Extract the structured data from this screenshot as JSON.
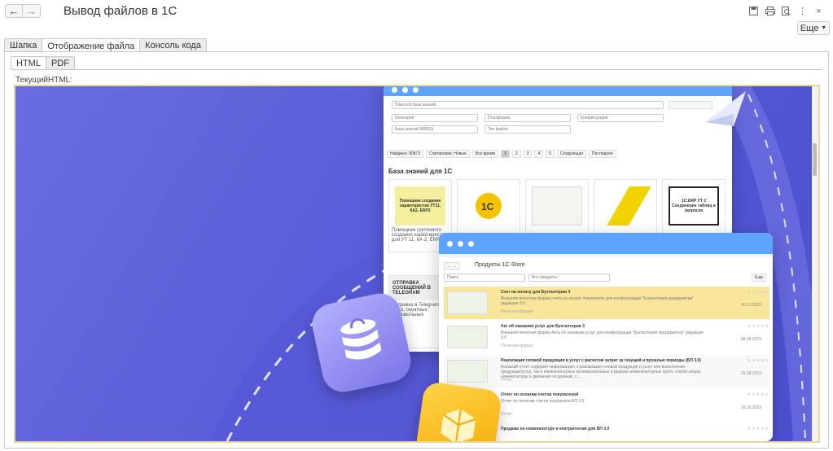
{
  "window": {
    "title": "Вывод файлов в 1С",
    "more": "Еще"
  },
  "icons": [
    "save-icon",
    "print-icon",
    "preview-icon",
    "menu-icon"
  ],
  "tabs": [
    "Шапка",
    "Отображение файла",
    "Консоль кода"
  ],
  "subtabs": [
    "HTML",
    "PDF"
  ],
  "field_label": "ТекущийHTML:",
  "content": {
    "search_placeholder": "Поиск по базе знаний",
    "filters": [
      "Категория",
      "Платформа",
      "Конфигурация",
      "База знаний (60663)",
      "Тип файла"
    ],
    "found": "Найдено: 60873",
    "sort": "Сортировка: Новые",
    "time": "Все время",
    "pages": [
      "1",
      "2",
      "3",
      "4",
      "5"
    ],
    "next": "Следующая",
    "last": "Последняя",
    "kb_title": "База знаний для 1С",
    "card1_img": "Помощник создания характеристик УТ11, КА2, ERP2",
    "card1_text": "Помощник группового создания характеристик для УТ 11, КА 2, ERP 2",
    "card3_img": "1C:ERP УТ 2 Соединение таблиц в запросах",
    "tg": "ОТПРАВКА СООБЩЕНИЙ В TELEGRAM",
    "tg_text": "Отправка в Telegram фото, печатных произвольных",
    "store_title": "Продукты 1C-Store",
    "store_search": "Поиск",
    "store_filter": "Все продукты",
    "store_more": "Еще",
    "rows": [
      {
        "title": "Счет на оплату для Бухгалтерии 3",
        "desc": "Внешняя печатная форма счета на оплату покупателю для конфигурации \"Бухгалтерия предприятия\" редакция 3.0",
        "kind": "Печатная форма",
        "date": "06.11.2023"
      },
      {
        "title": "Акт об оказании услуг для Бухгалтерии 3",
        "desc": "Внешняя печатная форма Акта об оказании услуг для конфигурации \"Бухгалтерия предприятия\" редакция 3.0",
        "kind": "Печатная форма",
        "date": "06.06.2023"
      },
      {
        "title": "Реализация готовой продукции и услуг с расчетом затрат за текущий и прошлые периоды (БП 3.0)",
        "desc": "Внешний отчет содержит информацию о реализации готовой продукции и услуг или выполнения продукции/услуг, так и номенклатурных вспомогательных в разрезе номенклатурных групп, статей затрат, номенклатуры и движения по данным, с...",
        "kind": "Отчет",
        "date": "26.08.2023"
      },
      {
        "title": "Отчет по оплатам счетов покупателей",
        "desc": "Отчет по оплатам счетов покупателя БП 3.0",
        "kind": "Отчет",
        "date": "16.10.2023"
      },
      {
        "title": "Продажи по номенклатуре и контрагентам для БП 3.0",
        "desc": "",
        "kind": "",
        "date": ""
      }
    ],
    "ratings": [
      "0",
      "0",
      "0",
      "0",
      "0"
    ]
  }
}
